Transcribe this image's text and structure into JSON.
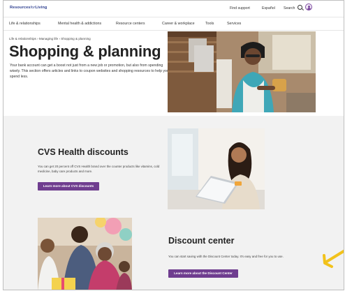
{
  "header": {
    "logo_main": "Resources",
    "logo_suffix": "for",
    "logo_end": "Living",
    "find_support": "Find support",
    "espanol": "Español",
    "search": "Search"
  },
  "nav": {
    "items": [
      "Life & relationships",
      "Mental health & addictions",
      "Resource centers",
      "Career & workplace",
      "Tools",
      "Services"
    ]
  },
  "breadcrumb": "Life & relationships  ›  Managing life  ›  Shopping & planning",
  "hero": {
    "title": "Shopping & planning",
    "intro": "Your bank account can get a boost not just from a new job or promotion, but also from spending wisely. This section offers articles and links to coupon websites and shopping resources to help you spend less."
  },
  "cvs": {
    "title": "CVS Health discounts",
    "description": "You can get 20 percent off CVS Health brand over the counter products like vitamins, cold medicine, baby care products and more.",
    "button": "Learn more about CVS discounts"
  },
  "discount_center": {
    "title": "Discount center",
    "description": "You can start saving with the Discount Center today. It's easy and free for you to use.",
    "button": "Learn more about the Discount Center"
  },
  "colors": {
    "brand_navy": "#2c3e8f",
    "button_purple": "#6f3d8f",
    "band_gray": "#f2f2f2",
    "arrow_yellow": "#f2c21b"
  }
}
